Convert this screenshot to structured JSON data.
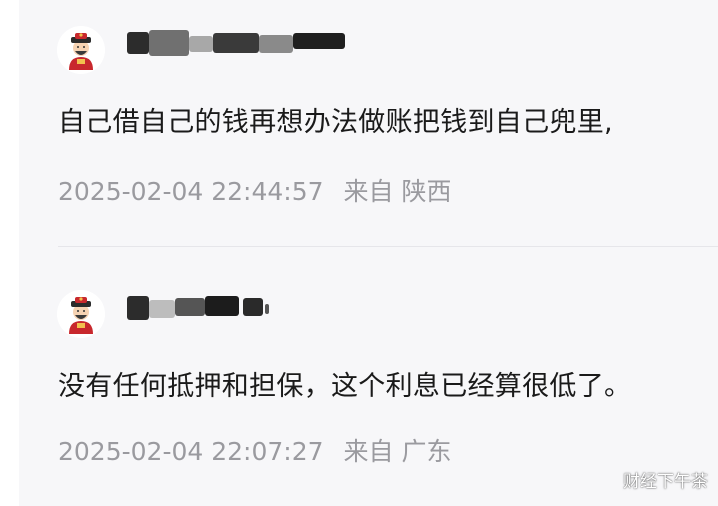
{
  "comments": [
    {
      "avatar_icon": "caishen-avatar-icon",
      "text": "自己借自己的钱再想办法做账把钱到自己兜里,",
      "timestamp": "2025-02-04 22:44:57",
      "location": "来自 陕西"
    },
    {
      "avatar_icon": "caishen-avatar-icon",
      "text": "没有任何抵押和担保，这个利息已经算很低了。",
      "timestamp": "2025-02-04 22:07:27",
      "location": "来自 广东"
    }
  ],
  "watermark": "财经下午茶",
  "colors": {
    "panel_bg": "#f7f7f9",
    "text": "#1a1a1a",
    "meta": "#9a9a9f",
    "divider": "#e6e6ea"
  }
}
